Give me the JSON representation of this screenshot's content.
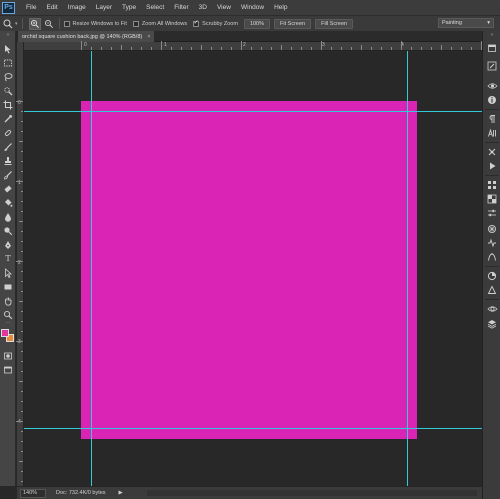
{
  "app": {
    "logo_text": "Ps"
  },
  "menu": [
    "File",
    "Edit",
    "Image",
    "Layer",
    "Type",
    "Select",
    "Filter",
    "3D",
    "View",
    "Window",
    "Help"
  ],
  "options_bar": {
    "checkboxes": [
      {
        "label": "Resize Windows to Fit",
        "checked": false
      },
      {
        "label": "Zoom All Windows",
        "checked": false
      },
      {
        "label": "Scrubby Zoom",
        "checked": true
      }
    ],
    "buttons": [
      "100%",
      "Fit Screen",
      "Fill Screen"
    ],
    "workspace": "Painting"
  },
  "document_tab": {
    "title": "orchid square cushion back.jpg @ 140% (RGB/8)",
    "close": "×"
  },
  "rulers": {
    "horizontal_labels": [
      "0",
      "1",
      "2",
      "3",
      "4"
    ],
    "vertical_labels": [
      "0",
      "1",
      "2",
      "3",
      "4"
    ]
  },
  "canvas": {
    "fill_color": "#d924b5",
    "guide_color": "#34c9d6",
    "pasteboard_color": "#282828"
  },
  "colors": {
    "foreground": "#e0389c",
    "background": "#e98a3a"
  },
  "status": {
    "zoom": "140%",
    "doc_info": "Doc: 732.4K/0 bytes",
    "arrow": "▶"
  }
}
